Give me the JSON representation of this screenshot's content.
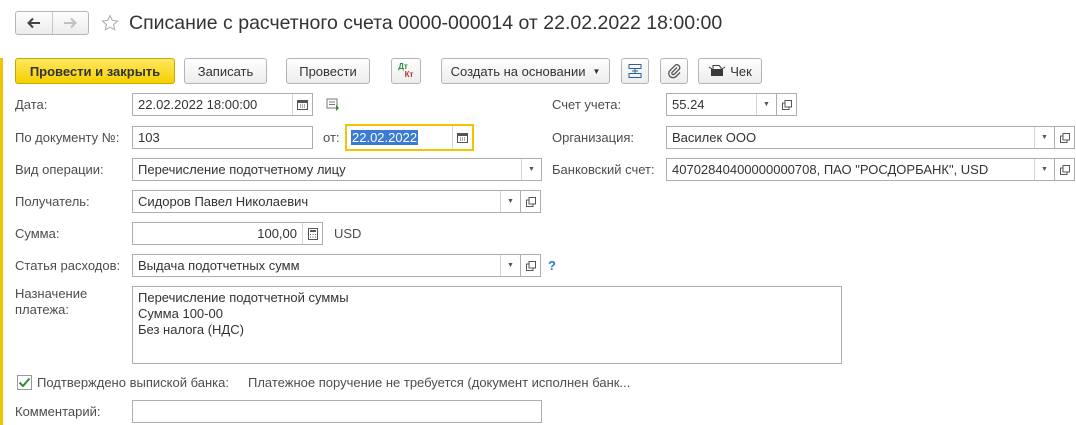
{
  "window": {
    "title": "Списание с расчетного счета 0000-000014 от 22.02.2022 18:00:00"
  },
  "toolbar": {
    "post_close_label": "Провести и закрыть",
    "save_label": "Записать",
    "post_label": "Провести",
    "dtkt_top": "Дт",
    "dtkt_bottom": "Кт",
    "create_based_label": "Создать на основании",
    "check_label": "Чек"
  },
  "form": {
    "date": {
      "label": "Дата:",
      "value": "22.02.2022 18:00:00"
    },
    "doc_number": {
      "label": "По документу №:",
      "value": "103"
    },
    "doc_date": {
      "label": "от:",
      "value": "22.02.2022"
    },
    "operation_type": {
      "label": "Вид операции:",
      "value": "Перечисление подотчетному лицу"
    },
    "recipient": {
      "label": "Получатель:",
      "value": "Сидоров Павел Николаевич"
    },
    "amount": {
      "label": "Сумма:",
      "value": "100,00",
      "currency": "USD"
    },
    "expense_item": {
      "label": "Статья расходов:",
      "value": "Выдача подотчетных сумм",
      "help": "?"
    },
    "purpose": {
      "label_line1": "Назначение",
      "label_line2": "платежа:",
      "lines": [
        "Перечисление подотчетной суммы",
        "Сумма 100-00",
        "Без налога (НДС)"
      ]
    },
    "confirmed": {
      "checked": true,
      "label": "Подтверждено выпиской банка:",
      "note": "Платежное поручение не требуется (документ исполнен банк..."
    },
    "comment": {
      "label": "Комментарий:",
      "value": ""
    },
    "account": {
      "label": "Счет учета:",
      "value": "55.24"
    },
    "organization": {
      "label": "Организация:",
      "value": "Василек ООО"
    },
    "bank_account": {
      "label": "Банковский счет:",
      "value": "40702840400000000708, ПАО \"РОСДОРБАНК\", USD"
    }
  },
  "colors": {
    "accent_yellow": "#f5d000",
    "focus_border": "#f3c400",
    "selection": "#3a7bd5",
    "help_blue": "#2a7bd5",
    "check_green": "#2e8b3a"
  },
  "icons": {
    "back": "arrow-left-icon",
    "forward": "arrow-right-icon",
    "favorite": "star-icon",
    "calendar": "calendar-icon",
    "open": "open-form-icon",
    "structure": "structure-icon",
    "attach": "paperclip-icon",
    "check_print": "receipt-icon",
    "calculator": "calculator-icon",
    "history": "document-history-icon"
  }
}
